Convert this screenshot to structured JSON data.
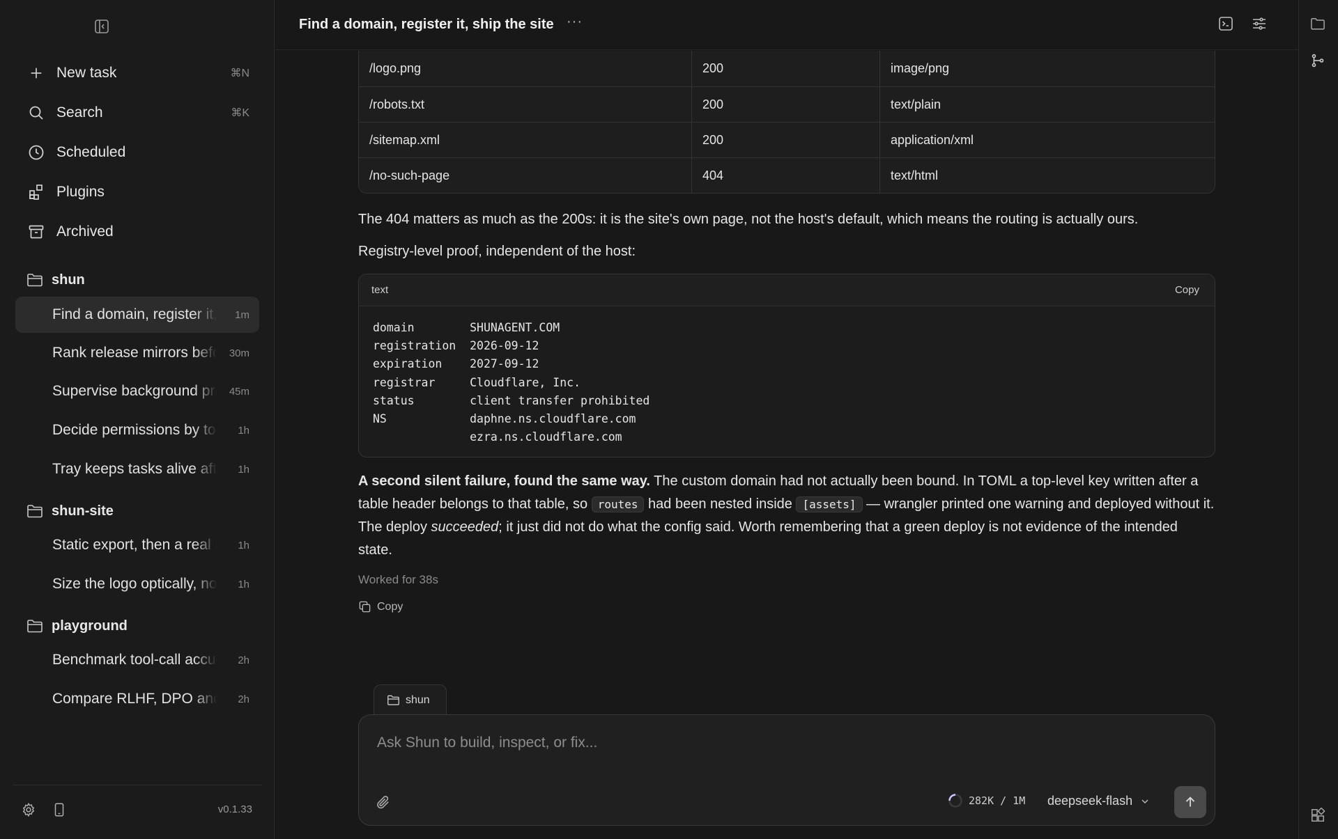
{
  "sidebar": {
    "nav": [
      {
        "label": "New task",
        "shortcut": "⌘N",
        "icon": "plus-icon"
      },
      {
        "label": "Search",
        "shortcut": "⌘K",
        "icon": "search-icon"
      },
      {
        "label": "Scheduled",
        "shortcut": "",
        "icon": "clock-icon"
      },
      {
        "label": "Plugins",
        "shortcut": "",
        "icon": "plugins-icon"
      },
      {
        "label": "Archived",
        "shortcut": "",
        "icon": "archive-icon"
      }
    ],
    "groups": [
      {
        "name": "shun",
        "tasks": [
          {
            "label": "Find a domain, register it, ship the site",
            "age": "1m",
            "active": true
          },
          {
            "label": "Rank release mirrors before download",
            "age": "30m"
          },
          {
            "label": "Supervise background processes",
            "age": "45m"
          },
          {
            "label": "Decide permissions by tool",
            "age": "1h"
          },
          {
            "label": "Tray keeps tasks alive after close",
            "age": "1h"
          }
        ]
      },
      {
        "name": "shun-site",
        "tasks": [
          {
            "label": "Static export, then a real host",
            "age": "1h"
          },
          {
            "label": "Size the logo optically, not by pixels",
            "age": "1h"
          }
        ]
      },
      {
        "name": "playground",
        "tasks": [
          {
            "label": "Benchmark tool-call accuracy",
            "age": "2h"
          },
          {
            "label": "Compare RLHF, DPO and others",
            "age": "2h"
          }
        ]
      }
    ],
    "version": "v0.1.33"
  },
  "header": {
    "title": "Find a domain, register it, ship the site",
    "more": "···"
  },
  "routes_table": {
    "rows": [
      [
        "/logo.png",
        "200",
        "image/png"
      ],
      [
        "/robots.txt",
        "200",
        "text/plain"
      ],
      [
        "/sitemap.xml",
        "200",
        "application/xml"
      ],
      [
        "/no-such-page",
        "404",
        "text/html"
      ]
    ]
  },
  "message": {
    "p1": "The 404 matters as much as the 200s: it is the site's own page, not the host's default, which means the routing is actually ours.",
    "p2": "Registry-level proof, independent of the host:",
    "code": {
      "lang": "text",
      "copy": "Copy",
      "body": "domain        SHUNAGENT.COM\nregistration  2026-09-12\nexpiration    2027-09-12\nregistrar     Cloudflare, Inc.\nstatus        client transfer prohibited\nNS            daphne.ns.cloudflare.com\n              ezra.ns.cloudflare.com"
    },
    "p3": {
      "bold": "A second silent failure, found the same way.",
      "t1": " The custom domain had not actually been bound. In TOML a top-level key written after a table header belongs to that table, so ",
      "code1": "routes",
      "t2": " had been nested inside ",
      "code2": "[assets]",
      "t3": " — wrangler printed one warning and deployed without it. The deploy ",
      "em": "succeeded",
      "t4": "; it just did not do what the config said. Worth remembering that a green deploy is not evidence of the intended state."
    },
    "worked": "Worked for 38s",
    "copy": "Copy"
  },
  "composer": {
    "context_tab": "shun",
    "placeholder": "Ask Shun to build, inspect, or fix...",
    "context_usage": "282K / 1M",
    "model": "deepseek-flash"
  },
  "colors": {
    "background": "#181818",
    "sidebar": "#1b1b1b",
    "active_task": "#2c2c2c",
    "send_button": "#4a4a4a"
  }
}
